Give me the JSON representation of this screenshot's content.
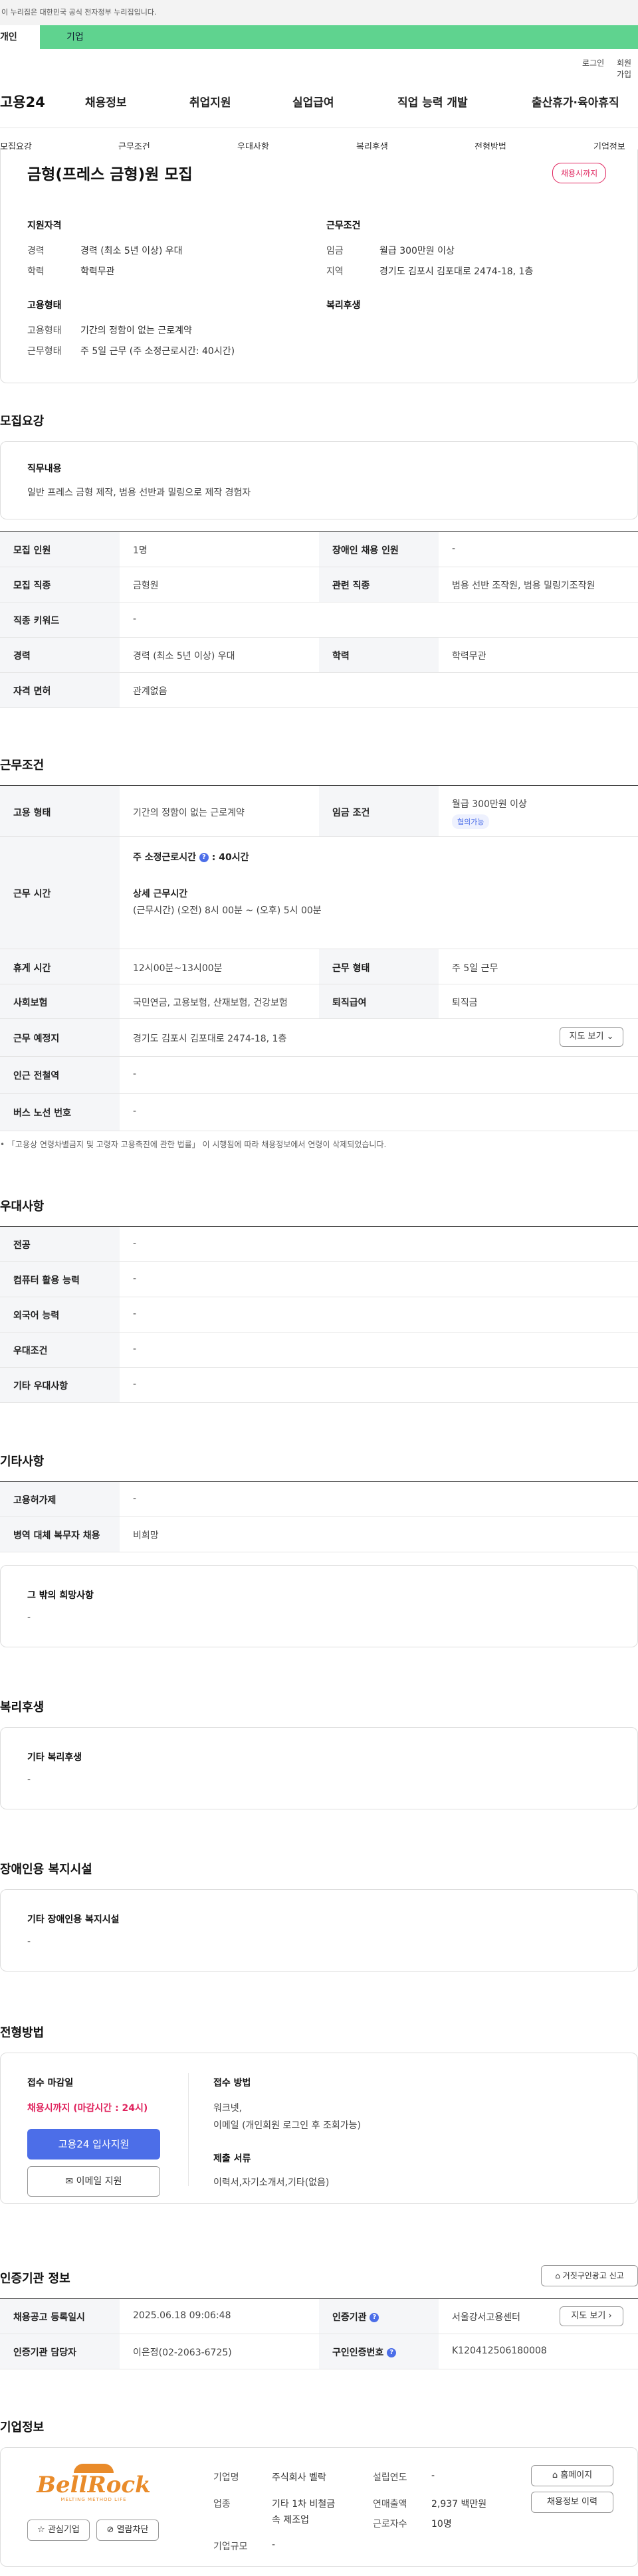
{
  "banner": {
    "text": "이 누리집은 대한민국 공식 전자정부 누리집입니다."
  },
  "top_tabs": {
    "personal": "개인",
    "company": "기업"
  },
  "util": {
    "login": "로그인",
    "join": "회원가입"
  },
  "header": {
    "logo": "고용24",
    "menu": [
      "채용정보",
      "취업지원",
      "실업급여",
      "직업 능력 개발",
      "출산휴가·육아휴직"
    ]
  },
  "subnav": [
    "모집요강",
    "근무조건",
    "우대사항",
    "복리후생",
    "전형방법",
    "기업정보"
  ],
  "job": {
    "title": "금형(프레스 금형)원 모집",
    "badge": "채용시까지",
    "qual_title": "지원자격",
    "career_label": "경력",
    "career_value": "경력 (최소 5년 이상) 우대",
    "edu_label": "학력",
    "edu_value": "학력무관",
    "work_title": "근무조건",
    "wage_label": "임금",
    "wage_value": "월급 300만원 이상",
    "loc_label": "지역",
    "loc_value": "경기도 김포시 김포대로 2474-18, 1층",
    "emp_title": "고용형태",
    "emptype_label": "고용형태",
    "emptype_value": "기간의 정함이 없는 근로계약",
    "worktype_label": "근무형태",
    "worktype_value": "주 5일 근무 (주 소정근로시간: 40시간)",
    "welfare_title": "복리후생"
  },
  "recruit": {
    "title": "모집요강",
    "duty_title": "직무내용",
    "duty_text": "일반 프레스 금형  제작,  범용 선반과 밀링으로 제작 경험자",
    "rows": [
      {
        "l1": "모집 인원",
        "v1": "1명",
        "l2": "장애인 채용 인원",
        "v2": "-"
      },
      {
        "l1": "모집 직종",
        "v1": "금형원",
        "l2": "관련 직종",
        "v2": "범용 선반 조작원, 범용 밀링기조작원"
      },
      {
        "l1": "직종 키워드",
        "v1": "-"
      },
      {
        "l1": "경력",
        "v1": "경력 (최소 5년 이상) 우대",
        "l2": "학력",
        "v2": "학력무관"
      },
      {
        "l1": "자격 면허",
        "v1": "관계없음"
      }
    ]
  },
  "conditions": {
    "title": "근무조건",
    "emp_label": "고용 형태",
    "emp_value": "기간의 정함이 없는 근로계약",
    "wage_label": "임금 조건",
    "wage_value": "월급 300만원 이상",
    "wage_pill": "협의가능",
    "hours_label": "근무 시간",
    "hours_weekly": "주 소정근로시간",
    "hours_weekly_value": ": 40시간",
    "hours_detail_title": "상세 근무시간",
    "hours_detail": "(근무시간) (오전) 8시 00분 ~ (오후) 5시 00분",
    "break_label": "휴게 시간",
    "break_value": "12시00분~13시00분",
    "worktype_label": "근무 형태",
    "worktype_value": "주 5일 근무",
    "insurance_label": "사회보험",
    "insurance_value": "국민연금, 고용보험, 산재보험, 건강보험",
    "severance_label": "퇴직급여",
    "severance_value": "퇴직금",
    "place_label": "근무 예정지",
    "place_value": "경기도 김포시 김포대로 2474-18, 1층",
    "map_btn": "지도 보기",
    "subway_label": "인근 전철역",
    "subway_value": "-",
    "bus_label": "버스 노선 번호",
    "bus_value": "-",
    "note": "「고용상 연령차별금지 및 고령자 고용촉진에 관한 법률」 이 시행됨에 따라 채용정보에서 연령이 삭제되었습니다."
  },
  "preference": {
    "title": "우대사항",
    "rows": [
      {
        "label": "전공",
        "value": "-"
      },
      {
        "label": "컴퓨터 활용 능력",
        "value": "-"
      },
      {
        "label": "외국어 능력",
        "value": "-"
      },
      {
        "label": "우대조건",
        "value": "-"
      },
      {
        "label": "기타 우대사항",
        "value": "-"
      }
    ]
  },
  "etc": {
    "title": "기타사항",
    "rows": [
      {
        "label": "고용허가제",
        "value": "-"
      },
      {
        "label": "병역 대체 복무자 채용",
        "value": "비희망"
      }
    ],
    "other_title": "그 밖의 희망사항",
    "other_value": "-"
  },
  "welfare": {
    "title": "복리후생",
    "box_title": "기타 복리후생",
    "box_value": "-"
  },
  "disabled": {
    "title": "장애인용 복지시설",
    "box_title": "기타 장애인용 복지시설",
    "box_value": "-"
  },
  "selection": {
    "title": "전형방법",
    "deadline_title": "접수 마감일",
    "deadline_value": "채용시까지 (마감시간 : 24시)",
    "apply_btn": "고용24 입사지원",
    "email_btn": "이메일 지원",
    "method_title": "접수 방법",
    "method_value_1": "워크넷,",
    "method_value_2": "이메일 (개인회원 로그인 후 조회가능)",
    "docs_title": "제출 서류",
    "docs_value": "이력서,자기소개서,기타(없음)"
  },
  "cert": {
    "title": "인증기관 정보",
    "report_btn": "거짓구인광고 신고",
    "reg_label": "채용공고 등록일시",
    "reg_value": "2025.06.18 09:06:48",
    "org_label": "인증기관",
    "org_value": "서울강서고용센터",
    "map_btn": "지도 보기",
    "manager_label": "인증기관 담당자",
    "manager_value": "이은정(02-2063-6725)",
    "num_label": "구인인증번호",
    "num_value": "K120412506180008"
  },
  "company": {
    "title": "기업정보",
    "logo_text": "BellRock",
    "logo_tagline": "MELTING METHOD LIFE",
    "fav_btn": "관심기업",
    "block_btn": "열람차단",
    "name_label": "기업명",
    "name_value": "주식회사 벨락",
    "industry_label": "업종",
    "industry_value_1": "기타 1차 비철금",
    "industry_value_2": "속 제조업",
    "size_label": "기업규모",
    "size_value": "-",
    "year_label": "설립연도",
    "year_value": "-",
    "sales_label": "연매출액",
    "sales_value": "2,937 백만원",
    "emp_label": "근로자수",
    "emp_value": "10명",
    "home_btn": "홈페이지",
    "history_btn": "채용정보 이력"
  },
  "colors": {
    "green": "#5fd38f",
    "blue": "#4c6ee8",
    "red": "#e0245e"
  }
}
